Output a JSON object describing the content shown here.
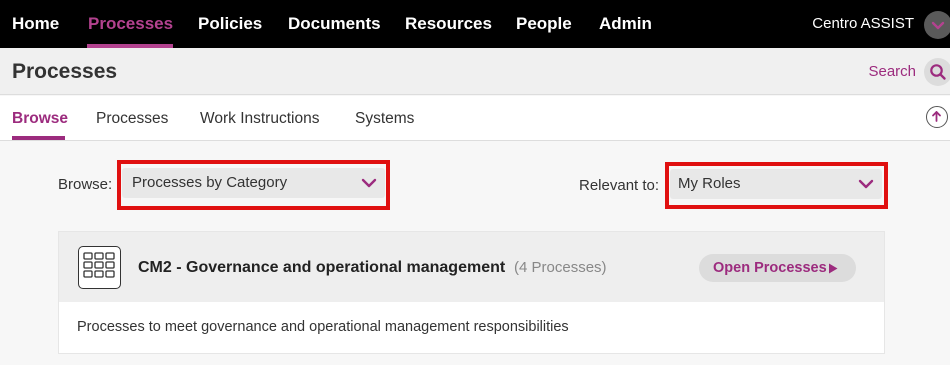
{
  "nav": {
    "items": [
      {
        "label": "Home"
      },
      {
        "label": "Processes"
      },
      {
        "label": "Policies"
      },
      {
        "label": "Documents"
      },
      {
        "label": "Resources"
      },
      {
        "label": "People"
      },
      {
        "label": "Admin"
      }
    ],
    "active": "Processes",
    "user_label": "Centro ASSIST"
  },
  "header": {
    "title": "Processes",
    "search_label": "Search"
  },
  "tabs": [
    {
      "label": "Browse"
    },
    {
      "label": "Processes"
    },
    {
      "label": "Work Instructions"
    },
    {
      "label": "Systems"
    }
  ],
  "filters": {
    "browse_label": "Browse:",
    "browse_value": "Processes by Category",
    "relevant_label": "Relevant to:",
    "relevant_value": "My Roles"
  },
  "card": {
    "title": "CM2 - Governance and operational management",
    "count": "(4 Processes)",
    "open_label": "Open Processes",
    "description": "Processes to meet governance and operational management responsibilities"
  },
  "colors": {
    "accent": "#9c2b7e",
    "nav_bg": "#000000",
    "highlight": "#e01010"
  },
  "icons": [
    "chevron-down-icon",
    "search-icon",
    "upload-icon",
    "grid-icon",
    "play-arrow-icon"
  ]
}
